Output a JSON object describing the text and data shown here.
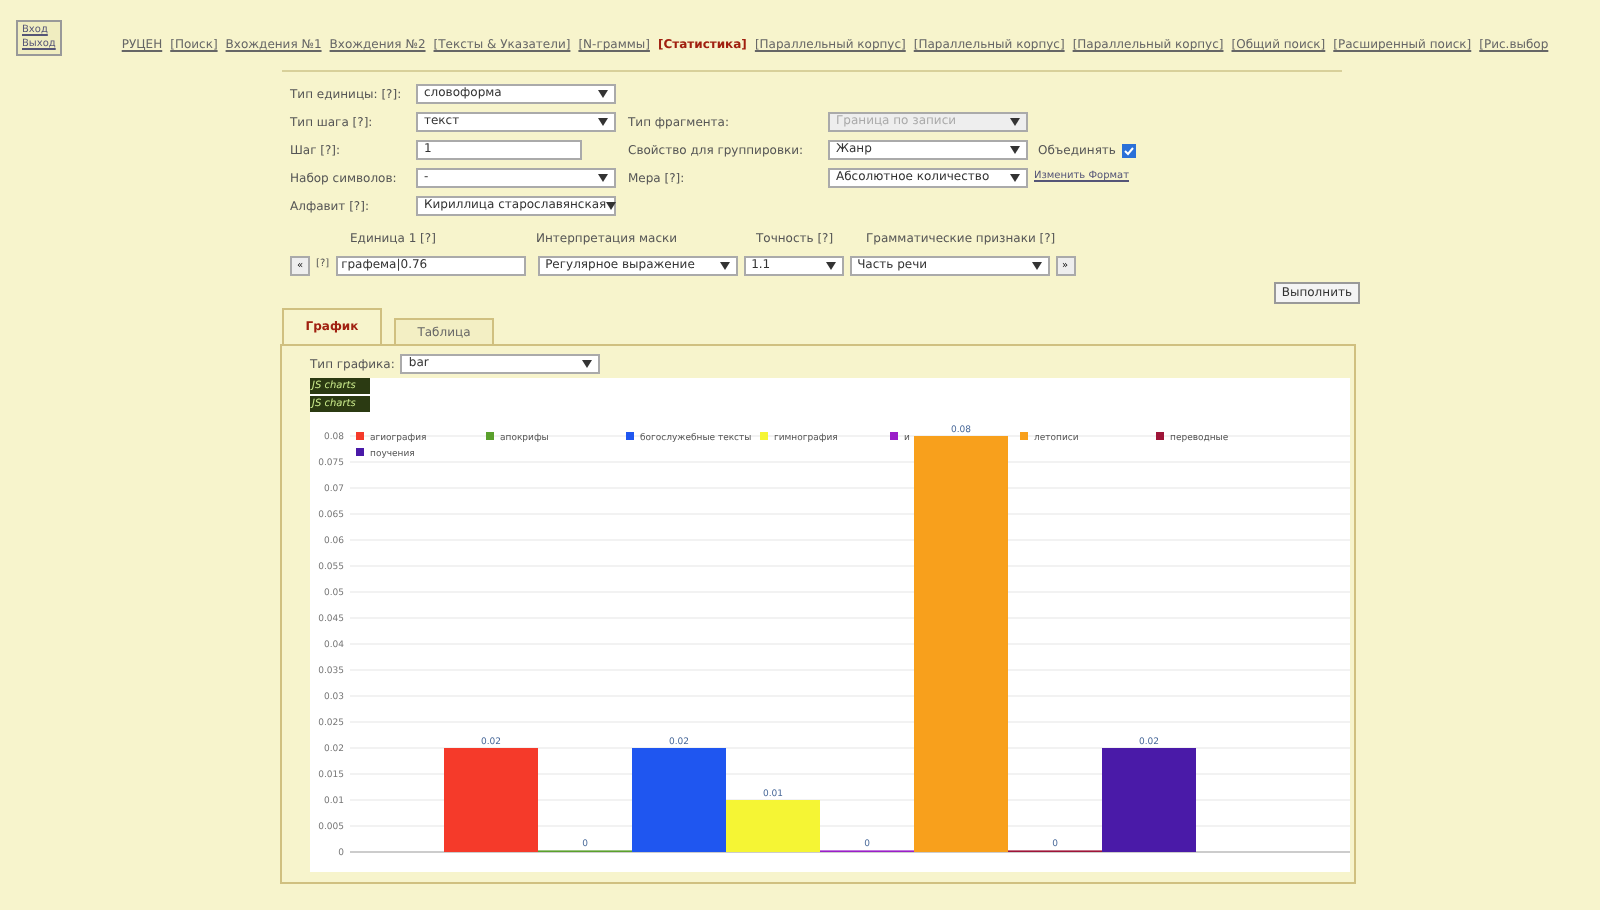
{
  "login_box": [
    "Вход",
    "Выход"
  ],
  "nav": [
    {
      "label": "РУЦЕН",
      "selected": false
    },
    {
      "label": "[Поиск]",
      "selected": false
    },
    {
      "label": "Вхождения №1",
      "selected": false
    },
    {
      "label": "Вхождения №2",
      "selected": false
    },
    {
      "label": "[Тексты & Указатели]",
      "selected": false
    },
    {
      "label": "[N-граммы]",
      "selected": false
    },
    {
      "label": "[Статистика]",
      "selected": true
    },
    {
      "label": "[Параллельный корпус]",
      "selected": false
    },
    {
      "label": "[Параллельный корпус]",
      "selected": false
    },
    {
      "label": "[Параллельный корпус]",
      "selected": false
    },
    {
      "label": "[Общий поиск]",
      "selected": false
    },
    {
      "label": "[Расширенный поиск]",
      "selected": false
    },
    {
      "label": "[Рис.выбор",
      "selected": false
    }
  ],
  "form": {
    "unit_type": {
      "label": "Тип единицы: [?]:",
      "value": "словоформа"
    },
    "step_type": {
      "label": "Тип шага [?]:",
      "value": "текст"
    },
    "fragment_type": {
      "label": "Тип фрагмента:",
      "value": "Граница по записи",
      "disabled": true
    },
    "step": {
      "label": "Шаг [?]:",
      "value": "1"
    },
    "group_by": {
      "label": "Свойство для группировки:",
      "value": "Жанр"
    },
    "merge": {
      "label": "Объединять",
      "checked": true
    },
    "charset": {
      "label": "Набор символов:",
      "value": "-"
    },
    "measure": {
      "label": "Мера [?]:",
      "value": "Абсолютное количество",
      "link": "Изменить Формат"
    },
    "alphabet": {
      "label": "Алфавит [?]:",
      "value": "Кириллица старославянская"
    }
  },
  "units": {
    "headers": [
      "Единица 1 [?]",
      "Интерпретация маски",
      "Точность [?]",
      "Грамматические признаки [?]"
    ],
    "remove": "«",
    "help": "[?]",
    "mask": "графема|0.76",
    "interpretation": "Регулярное выражение",
    "precision": "1.1",
    "grammar": "Часть речи",
    "add": "»"
  },
  "run_button": "Выполнить",
  "tabs": [
    {
      "label": "График",
      "selected": true
    },
    {
      "label": "Таблица",
      "selected": false
    }
  ],
  "chart_type": {
    "label": "Тип графика:",
    "value": "bar"
  },
  "logo": [
    "JS charts",
    "JS charts"
  ],
  "chart": {
    "chart_data": {
      "type": "bar",
      "data_labels": true,
      "grid": true,
      "legend": "top",
      "ylim": [
        0,
        0.08
      ],
      "yticks": [
        0,
        0.005,
        0.01,
        0.015,
        0.02,
        0.025,
        0.03,
        0.035,
        0.04,
        0.045,
        0.05,
        0.055,
        0.06,
        0.065,
        0.07,
        0.075,
        0.08
      ],
      "series": [
        {
          "name": "агиография",
          "color": "#f53a2a",
          "values": [
            0.02
          ]
        },
        {
          "name": "апокрифы",
          "color": "#5aa02c",
          "values": [
            0
          ]
        },
        {
          "name": "богослужебные тексты",
          "color": "#1f56f0",
          "values": [
            0.02
          ]
        },
        {
          "name": "гимнография",
          "color": "#f5f534",
          "values": [
            0.01
          ]
        },
        {
          "name": "и",
          "color": "#9a1ec8",
          "values": [
            0
          ]
        },
        {
          "name": "летописи",
          "color": "#f8a01c",
          "values": [
            0.08
          ]
        },
        {
          "name": "переводные",
          "color": "#9e1438",
          "values": [
            0
          ]
        },
        {
          "name": "поучения",
          "color": "#4a1aa8",
          "values": [
            0.02
          ]
        }
      ]
    }
  }
}
